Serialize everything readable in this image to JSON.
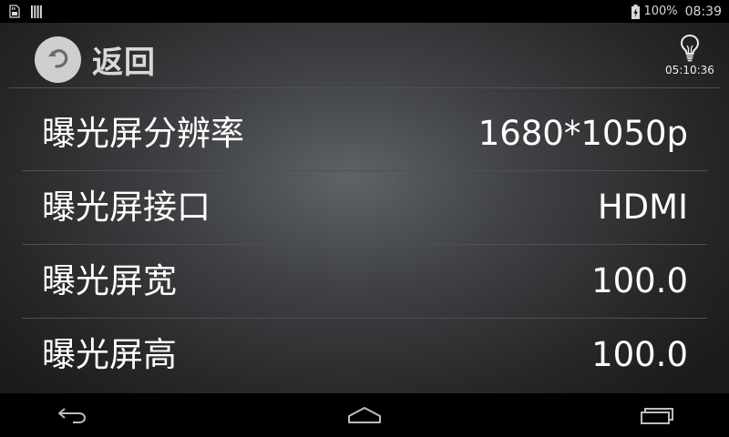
{
  "status_bar": {
    "battery_percent": "100%",
    "time": "08:39",
    "left_icons": [
      "sd-card-icon",
      "barcode-icon"
    ],
    "right_icons": [
      "battery-charging-icon"
    ]
  },
  "header": {
    "back_label": "返回",
    "timer_icon": "lightbulb-icon",
    "timer": "05:10:36"
  },
  "settings": [
    {
      "label": "曝光屏分辨率",
      "value": "1680*1050p"
    },
    {
      "label": "曝光屏接口",
      "value": "HDMI"
    },
    {
      "label": "曝光屏宽",
      "value": "100.0"
    },
    {
      "label": "曝光屏高",
      "value": "100.0"
    }
  ],
  "nav_bar": {
    "icons": [
      "nav-back-icon",
      "nav-home-icon",
      "nav-recents-icon"
    ]
  },
  "colors": {
    "text": "#ffffff",
    "back_circle": "#cfcfcf",
    "status_bar_bg": "#000000"
  }
}
